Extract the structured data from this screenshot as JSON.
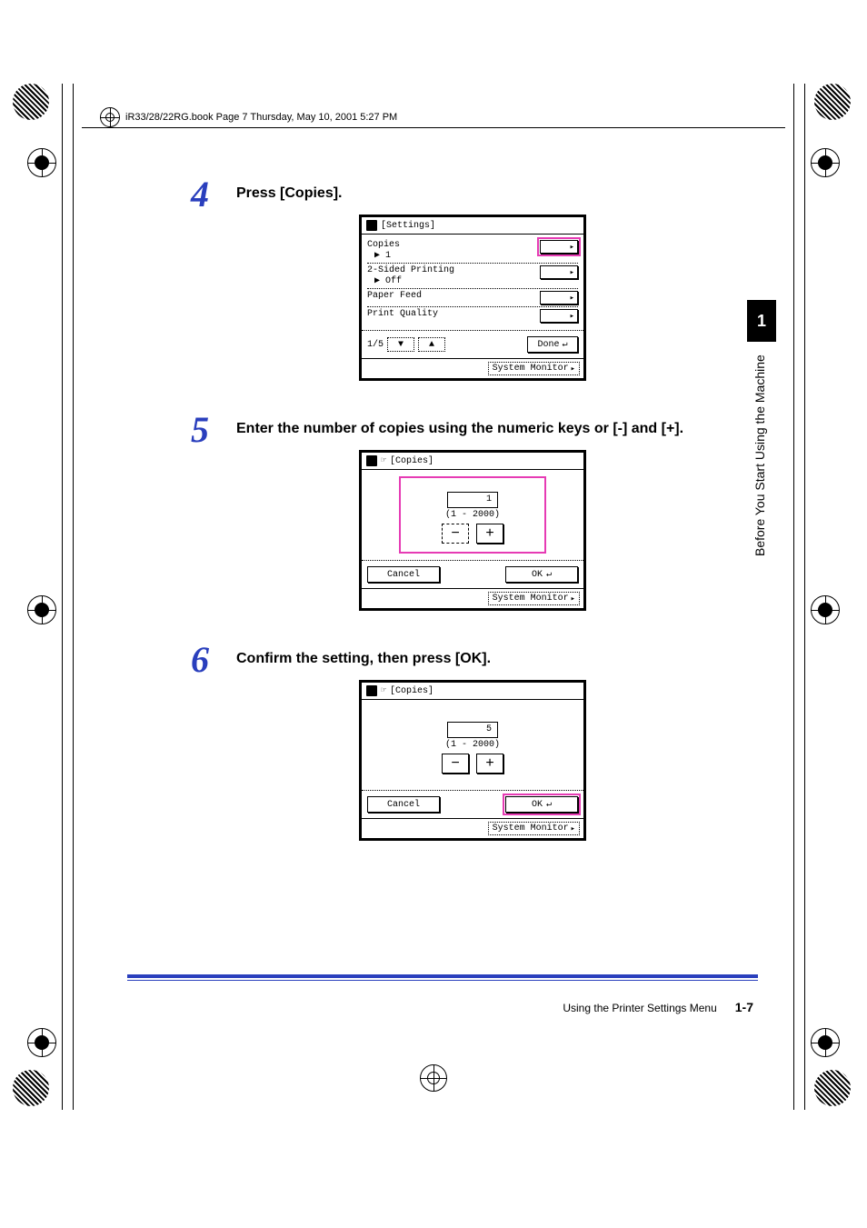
{
  "book_header": "iR33/28/22RG.book  Page 7  Thursday, May 10, 2001  5:27 PM",
  "side": {
    "chapter_num": "1",
    "chapter_title": "Before You Start Using the Machine"
  },
  "steps": {
    "s4": {
      "num": "4",
      "text": "Press [Copies]."
    },
    "s5": {
      "num": "5",
      "text": "Enter the number of copies using the numeric keys or [-] and [+]."
    },
    "s6": {
      "num": "6",
      "text": "Confirm the setting, then press [OK]."
    }
  },
  "lcd_settings": {
    "title": "[Settings]",
    "rows": {
      "copies_label": "Copies",
      "copies_sub": "▶ 1",
      "twosided_label": "2-Sided Printing",
      "twosided_sub": "▶ Off",
      "paper_label": "Paper Feed",
      "quality_label": "Print Quality"
    },
    "page_indicator": "1/5",
    "done": "Done",
    "sysmon": "System Monitor"
  },
  "lcd_copies1": {
    "title": "[Copies]",
    "value": "1",
    "range": "(1 - 2000)",
    "cancel": "Cancel",
    "ok": "OK",
    "sysmon": "System Monitor"
  },
  "lcd_copies2": {
    "title": "[Copies]",
    "value": "5",
    "range": "(1 - 2000)",
    "cancel": "Cancel",
    "ok": "OK",
    "sysmon": "System Monitor"
  },
  "footer": {
    "section": "Using the Printer Settings Menu",
    "page": "1-7"
  }
}
